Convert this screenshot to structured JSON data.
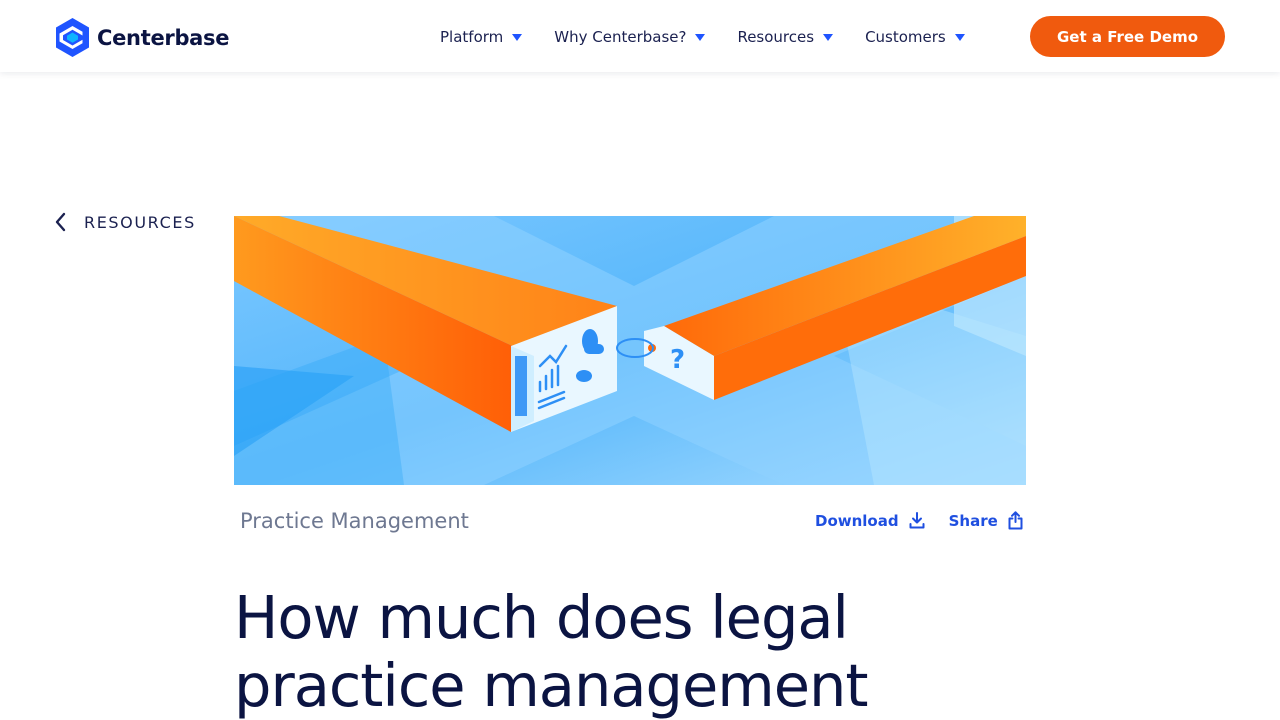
{
  "brand": {
    "name": "Centerbase",
    "accent": "#f05a0e",
    "link": "#1f4fe0",
    "navy": "#0b1442"
  },
  "nav": {
    "items": [
      {
        "label": "Platform",
        "icon": "caret-down-icon"
      },
      {
        "label": "Why Centerbase?",
        "icon": "caret-down-icon"
      },
      {
        "label": "Resources",
        "icon": "caret-down-icon"
      },
      {
        "label": "Customers",
        "icon": "caret-down-icon"
      }
    ],
    "cta_label": "Get a Free Demo"
  },
  "back_link": {
    "label": "RESOURCES",
    "icon": "chevron-left-icon"
  },
  "article": {
    "category": "Practice Management",
    "download_label": "Download",
    "download_icon": "download-icon",
    "share_label": "Share",
    "share_icon": "share-icon",
    "title": "How much does legal practice management"
  }
}
